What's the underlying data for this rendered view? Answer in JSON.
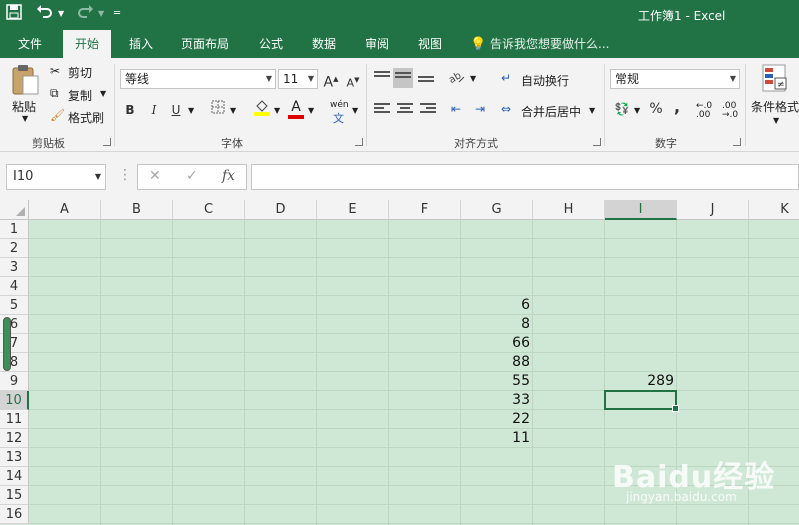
{
  "titlebar": {
    "title": "工作簿1 - Excel",
    "save_icon": "save-icon",
    "undo_icon": "undo-icon",
    "redo_icon": "redo-icon",
    "customize_icon": "customize-icon"
  },
  "tabs": [
    {
      "label": "文件"
    },
    {
      "label": "开始"
    },
    {
      "label": "插入"
    },
    {
      "label": "页面布局"
    },
    {
      "label": "公式"
    },
    {
      "label": "数据"
    },
    {
      "label": "审阅"
    },
    {
      "label": "视图"
    }
  ],
  "tellme": "告诉我您想要做什么...",
  "ribbon": {
    "clipboard": {
      "paste": "粘贴",
      "cut": "剪切",
      "copy": "复制",
      "format_painter": "格式刷",
      "label": "剪贴板"
    },
    "font": {
      "name": "等线",
      "size": "11",
      "bold": "B",
      "italic": "I",
      "underline": "U",
      "grow": "A",
      "shrink": "A",
      "fontcolor": "A",
      "phonetic": "wén",
      "label": "字体"
    },
    "alignment": {
      "wrap": "自动换行",
      "merge": "合并后居中",
      "label": "对齐方式"
    },
    "number": {
      "format": "常规",
      "percent": "%",
      "comma": ",",
      "label": "数字"
    },
    "styles": {
      "conditional": "条件格式"
    }
  },
  "formula_bar": {
    "name_box": "I10",
    "fx": "fx",
    "cancel": "✕",
    "enter": "✓"
  },
  "columns": [
    "A",
    "B",
    "C",
    "D",
    "E",
    "F",
    "G",
    "H",
    "I",
    "J",
    "K"
  ],
  "rows": [
    "1",
    "2",
    "3",
    "4",
    "5",
    "6",
    "7",
    "8",
    "9",
    "10",
    "11",
    "12",
    "13",
    "14",
    "15",
    "16"
  ],
  "cells": [
    {
      "col": "G",
      "row": "5",
      "value": "6"
    },
    {
      "col": "G",
      "row": "6",
      "value": "8"
    },
    {
      "col": "G",
      "row": "7",
      "value": "66"
    },
    {
      "col": "G",
      "row": "8",
      "value": "88"
    },
    {
      "col": "G",
      "row": "9",
      "value": "55"
    },
    {
      "col": "G",
      "row": "10",
      "value": "33"
    },
    {
      "col": "G",
      "row": "11",
      "value": "22"
    },
    {
      "col": "G",
      "row": "12",
      "value": "11"
    },
    {
      "col": "I",
      "row": "9",
      "value": "289"
    }
  ],
  "selected_cell": {
    "col": "I",
    "row": "10"
  },
  "watermark": {
    "text": "Baidu经验",
    "url": "jingyan.baidu.com"
  },
  "colors": {
    "accent": "#217346",
    "grid_bg": "#cfe8d5"
  }
}
